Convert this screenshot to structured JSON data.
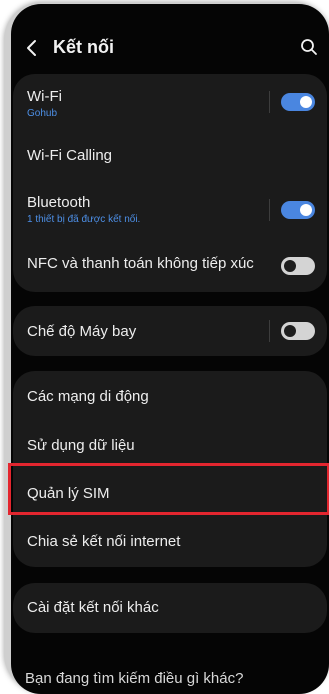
{
  "header": {
    "title": "Kết nối"
  },
  "connections": {
    "wifi": {
      "label": "Wi-Fi",
      "network": "Gohub",
      "enabled": true
    },
    "wifi_calling": {
      "label": "Wi-Fi Calling"
    },
    "bluetooth": {
      "label": "Bluetooth",
      "status": "1 thiết bị đã được kết nối.",
      "enabled": true
    },
    "nfc": {
      "label": "NFC và thanh toán không tiếp xúc",
      "enabled": false
    }
  },
  "airplane": {
    "label": "Chế độ Máy bay",
    "enabled": false
  },
  "network": {
    "mobile_networks": "Các mạng di động",
    "data_usage": "Sử dụng dữ liệu",
    "sim_manager": "Quản lý SIM",
    "hotspot": "Chia sẻ kết nối internet"
  },
  "more": {
    "other_settings": "Cài đặt kết nối khác"
  },
  "footer": {
    "looking_for": "Bạn đang tìm kiếm điều gì khác?"
  },
  "colors": {
    "accent": "#4a86e0",
    "highlight": "#e3262f",
    "background": "#050505"
  }
}
